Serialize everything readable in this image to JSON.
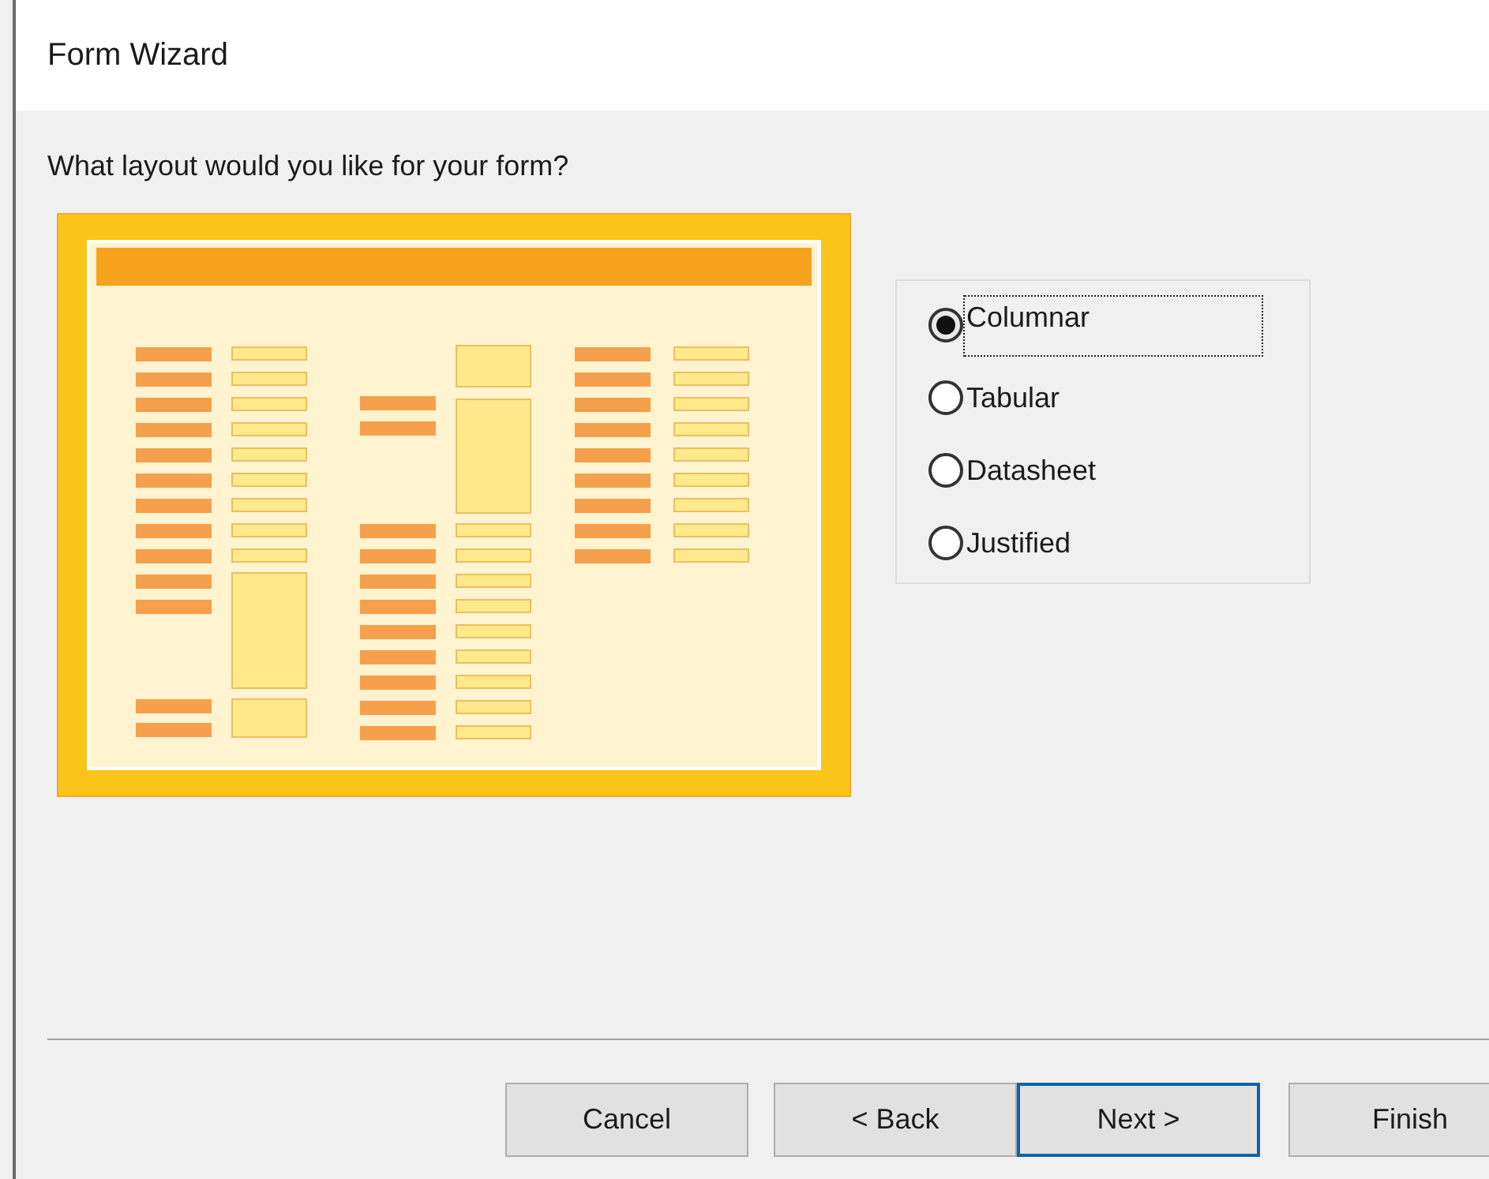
{
  "window": {
    "title": "Form Wizard"
  },
  "prompt": "What layout would you like for your form?",
  "layout_options": [
    {
      "label": "Columnar",
      "selected": true,
      "focused": true
    },
    {
      "label": "Tabular",
      "selected": false,
      "focused": false
    },
    {
      "label": "Datasheet",
      "selected": false,
      "focused": false
    },
    {
      "label": "Justified",
      "selected": false,
      "focused": false
    }
  ],
  "buttons": [
    {
      "label": "Cancel",
      "default": false
    },
    {
      "label": "< Back",
      "default": false
    },
    {
      "label": "Next >",
      "default": true
    },
    {
      "label": "Finish",
      "default": false
    }
  ]
}
